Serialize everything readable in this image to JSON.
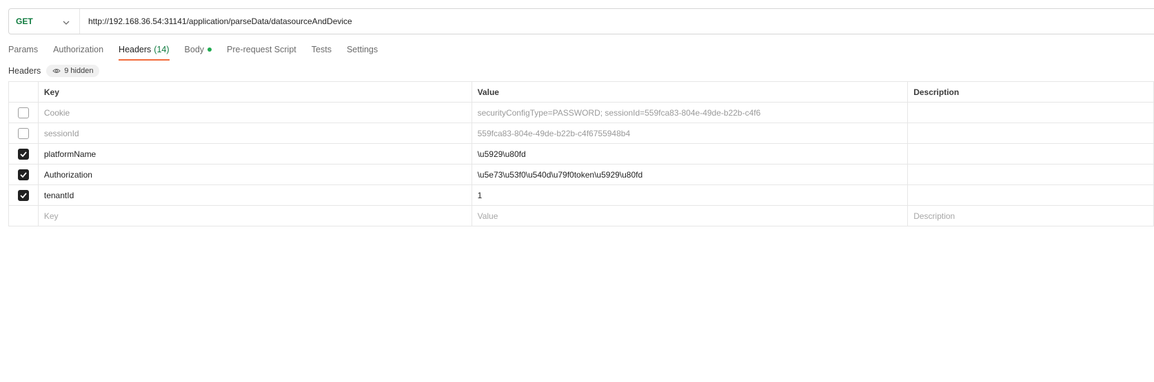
{
  "request": {
    "method": "GET",
    "url": "http://192.168.36.54:31141/application/parseData/datasourceAndDevice"
  },
  "tabs": [
    {
      "label": "Params"
    },
    {
      "label": "Authorization"
    },
    {
      "label": "Headers",
      "count": "(14)"
    },
    {
      "label": "Body"
    },
    {
      "label": "Pre-request Script"
    },
    {
      "label": "Tests"
    },
    {
      "label": "Settings"
    }
  ],
  "headers_section": {
    "title": "Headers",
    "hidden_label": "9 hidden"
  },
  "table": {
    "columns": {
      "key": "Key",
      "value": "Value",
      "description": "Description"
    },
    "rows": [
      {
        "checked": false,
        "key": "Cookie",
        "value": "securityConfigType=PASSWORD; sessionId=559fca83-804e-49de-b22b-c4f6",
        "description": ""
      },
      {
        "checked": false,
        "key": "sessionId",
        "value": "559fca83-804e-49de-b22b-c4f6755948b4",
        "description": ""
      },
      {
        "checked": true,
        "key": "platformName",
        "value": "\\u5929\\u80fd",
        "description": ""
      },
      {
        "checked": true,
        "key": "Authorization",
        "value": "\\u5e73\\u53f0\\u540d\\u79f0token\\u5929\\u80fd",
        "description": ""
      },
      {
        "checked": true,
        "key": "tenantId",
        "value": "1",
        "description": ""
      }
    ],
    "placeholder": {
      "key": "Key",
      "value": "Value",
      "description": "Description"
    }
  },
  "colors": {
    "accent": "#f26b3a",
    "method": "#0f7b3f",
    "dot": "#1faa4f"
  }
}
